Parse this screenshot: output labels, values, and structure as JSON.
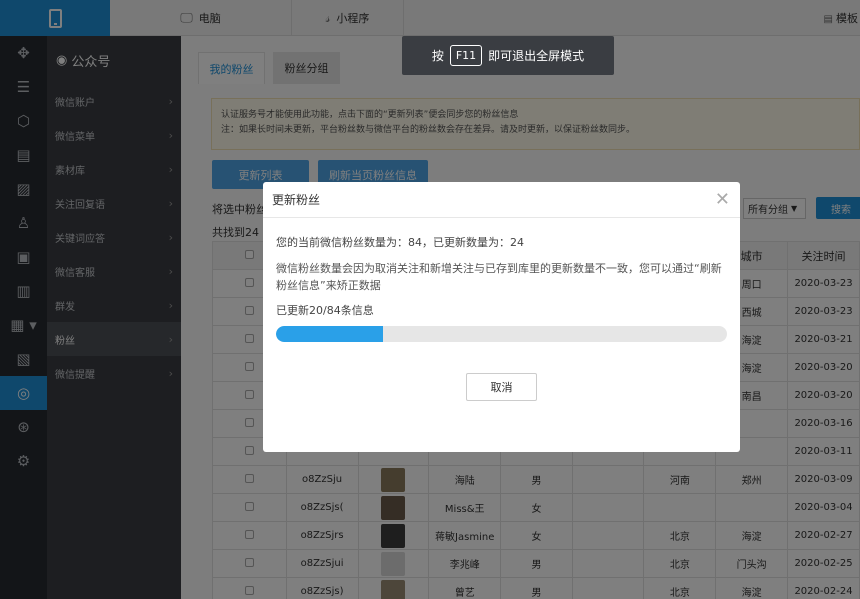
{
  "topbar": {
    "tabs": [
      {
        "label": "电脑",
        "icon": "monitor-icon"
      },
      {
        "label": "小程序",
        "icon": "miniprogram-icon"
      }
    ],
    "template_label": "模板"
  },
  "fullscreen_hint": {
    "before": "按",
    "key": "F11",
    "after": "即可退出全屏模式"
  },
  "sidebar": {
    "title": "公众号",
    "items": [
      {
        "label": "微信账户"
      },
      {
        "label": "微信菜单"
      },
      {
        "label": "素材库"
      },
      {
        "label": "关注回复语"
      },
      {
        "label": "关键词应答"
      },
      {
        "label": "微信客服"
      },
      {
        "label": "群发"
      },
      {
        "label": "粉丝",
        "active": true
      },
      {
        "label": "微信提醒"
      }
    ]
  },
  "tabs": [
    "我的粉丝",
    "粉丝分组"
  ],
  "notice": {
    "line1": "认证服务号才能使用此功能，点击下面的“更新列表”便会同步您的粉丝信息",
    "line2": "注：如果长时间未更新，平台粉丝数与微信平台的粉丝数会存在差异。请及时更新，以保证粉丝数同步。"
  },
  "buttons": {
    "update_list": "更新列表",
    "refresh_page": "刷新当页粉丝信息"
  },
  "selected_prefix": "将选中粉丝",
  "found_prefix": "共找到24",
  "group_select": "所有分组",
  "search_button": "搜索",
  "table": {
    "headers": [
      "",
      "",
      "",
      "",
      "",
      "",
      "",
      "城市",
      "关注时间"
    ],
    "rows": [
      {
        "id": "",
        "nick": "",
        "gender": "",
        "country": "",
        "province": "",
        "city": "周口",
        "date": "2020-03-23",
        "avatar": ""
      },
      {
        "id": "",
        "nick": "",
        "gender": "",
        "country": "",
        "province": "",
        "city": "西城",
        "date": "2020-03-23",
        "avatar": ""
      },
      {
        "id": "",
        "nick": "",
        "gender": "",
        "country": "",
        "province": "",
        "city": "海淀",
        "date": "2020-03-21",
        "avatar": ""
      },
      {
        "id": "",
        "nick": "",
        "gender": "",
        "country": "",
        "province": "",
        "city": "海淀",
        "date": "2020-03-20",
        "avatar": ""
      },
      {
        "id": "",
        "nick": "",
        "gender": "",
        "country": "",
        "province": "",
        "city": "南昌",
        "date": "2020-03-20",
        "avatar": ""
      },
      {
        "id": "",
        "nick": "",
        "gender": "",
        "country": "",
        "province": "",
        "city": "",
        "date": "2020-03-16",
        "avatar": ""
      },
      {
        "id": "",
        "nick": "",
        "gender": "",
        "country": "",
        "province": "",
        "city": "",
        "date": "2020-03-11",
        "avatar": ""
      },
      {
        "id": "o8ZzSju",
        "nick": "海陆",
        "gender": "男",
        "country": "",
        "province": "河南",
        "city": "郑州",
        "date": "2020-03-09",
        "avatar": "#8a7a5c"
      },
      {
        "id": "o8ZzSjs(",
        "nick": "Miss&王",
        "gender": "女",
        "country": "",
        "province": "",
        "city": "",
        "date": "2020-03-04",
        "avatar": "#6b5a4a"
      },
      {
        "id": "o8ZzSjrs",
        "nick": "蒋敏Jasmine",
        "gender": "女",
        "country": "",
        "province": "北京",
        "city": "海淀",
        "date": "2020-02-27",
        "avatar": "#3c3c3c"
      },
      {
        "id": "o8ZzSjui",
        "nick": "李兆峰",
        "gender": "男",
        "country": "",
        "province": "北京",
        "city": "门头沟",
        "date": "2020-02-25",
        "avatar": "#d8d8d8"
      },
      {
        "id": "o8ZzSjs)",
        "nick": "曾艺",
        "gender": "男",
        "country": "",
        "province": "北京",
        "city": "海淀",
        "date": "2020-02-24",
        "avatar": "#9a8c74"
      }
    ]
  },
  "dialog": {
    "title": "更新粉丝",
    "count_line": "您的当前微信粉丝数量为：84，已更新数量为：24",
    "warning": "微信粉丝数量会因为取消关注和新增关注与已存到库里的更新数量不一致，您可以通过“刷新粉丝信息”来矫正数据",
    "progress_text": "已更新20/84条信息",
    "progress_fraction": 0.2381,
    "cancel": "取消"
  },
  "colors": {
    "accent": "#1f90d8",
    "progress": "#2aa0e8"
  }
}
